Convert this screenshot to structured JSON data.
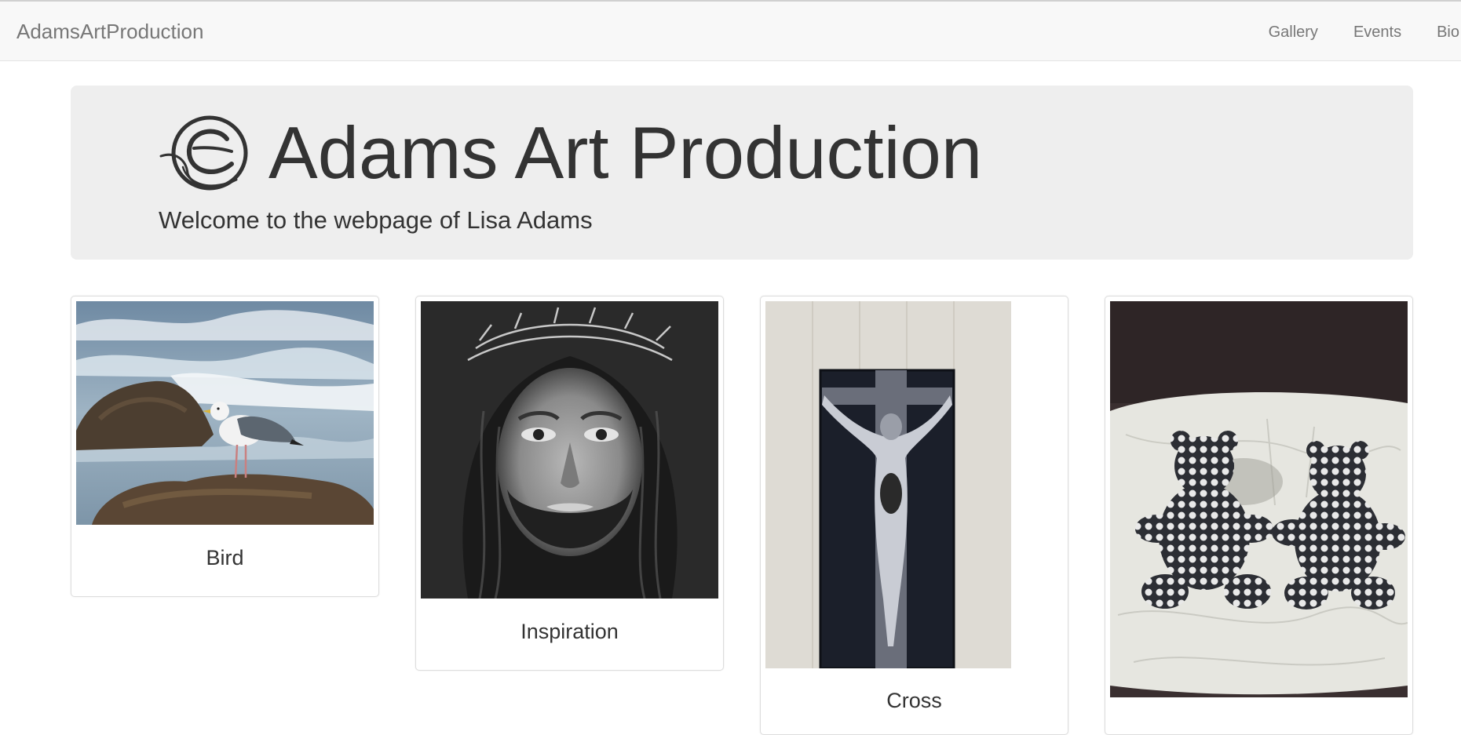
{
  "navbar": {
    "brand": "AdamsArtProduction",
    "links": [
      "Gallery",
      "Events",
      "Bio"
    ]
  },
  "hero": {
    "title": "Adams Art Production",
    "subtitle": "Welcome to the webpage of Lisa Adams",
    "logo_icon": "swirl-circle-logo-icon"
  },
  "gallery": [
    {
      "caption": "Bird",
      "image": "seagull-on-rock-photo"
    },
    {
      "caption": "Inspiration",
      "image": "portrait-with-crown-of-thorns-painting"
    },
    {
      "caption": "Cross",
      "image": "crucifix-painting"
    },
    {
      "caption": "",
      "image": "polka-dot-teddy-bears-photo"
    }
  ],
  "colors": {
    "navbar_bg": "#f8f8f8",
    "nav_text": "#777777",
    "hero_bg": "#eeeeee",
    "text": "#333333",
    "card_border": "#dddddd"
  }
}
